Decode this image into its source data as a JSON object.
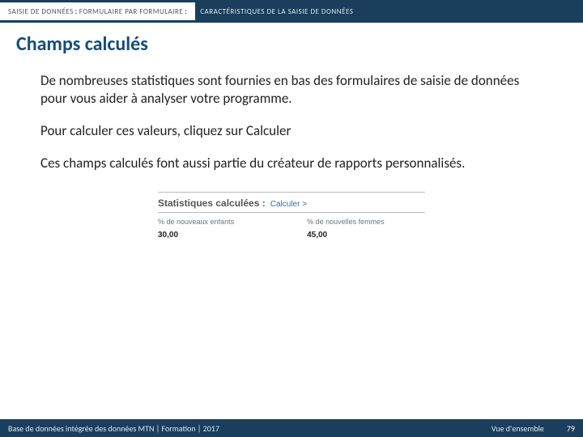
{
  "breadcrumb": {
    "prefix": "SAISIE DE DONNÉES",
    "colon": ":",
    "middle": "FORMULAIRE PAR FORMULAIRE",
    "colon2": ":",
    "suffix": "CARACTÉRISTIQUES DE LA SAISIE DE DONNÉES"
  },
  "title": "Champs calculés",
  "paragraphs": {
    "p1": "De nombreuses statistiques sont fournies en bas des formulaires de saisie de données pour vous aider à analyser votre programme.",
    "p2": "Pour calculer ces valeurs, cliquez sur Calculer",
    "p3": "Ces champs calculés font aussi partie du créateur de rapports personnalisés."
  },
  "figure": {
    "title": "Statistiques calculées :",
    "link": "Calculer >",
    "col1_label": "% de nouveaux enfants",
    "col1_value": "30,00",
    "col2_label": "% de nouvelles femmes",
    "col2_value": "45,00"
  },
  "footer": {
    "left": "Base de données intégrée des données MTN  |  Formation  |  2017",
    "right": "Vue d'ensemble",
    "page": "79"
  }
}
